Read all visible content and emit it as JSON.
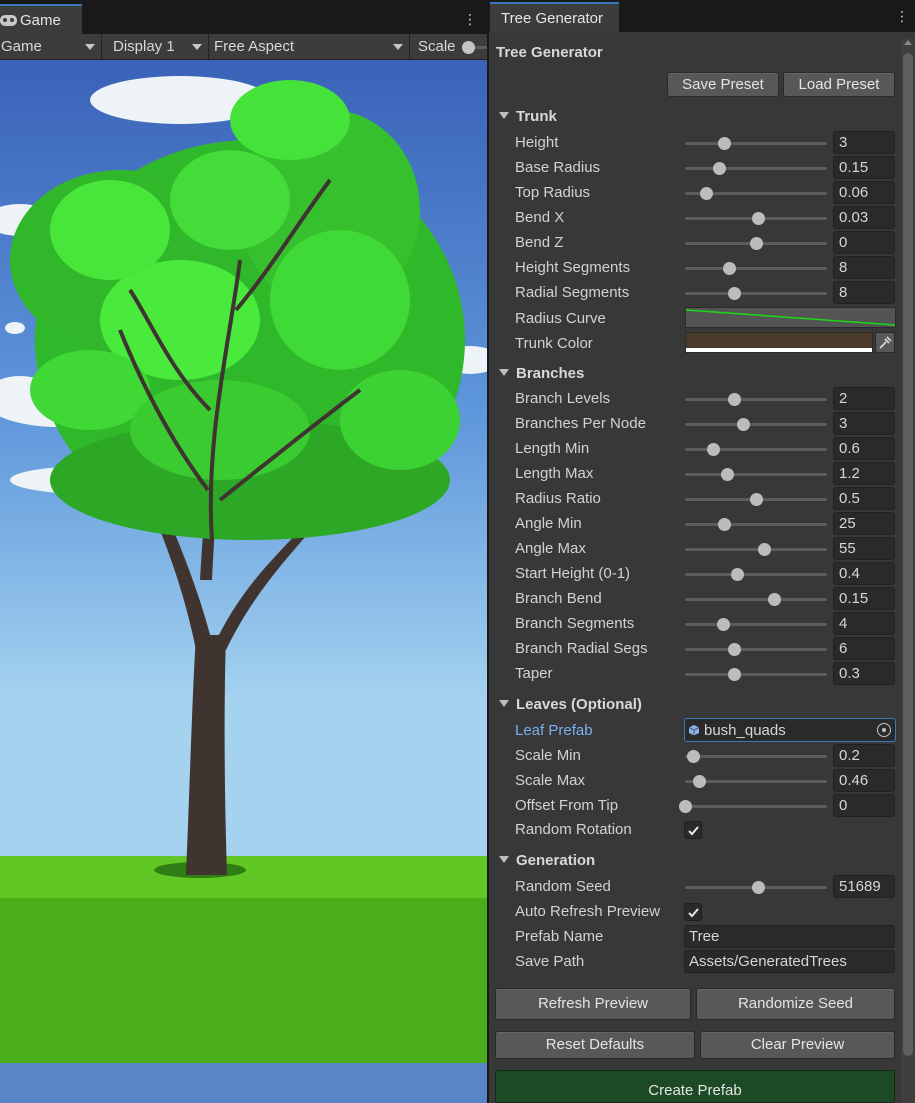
{
  "game_view": {
    "tab_label": "Game",
    "tab_icon": "gamepad-icon",
    "toolbar": {
      "mode": "Game",
      "display": "Display 1",
      "aspect": "Free Aspect",
      "scale_label": "Scale"
    },
    "colors": {
      "sky_top": "#3d6fc4",
      "sky_bottom": "#9fd0ee",
      "leaves": "#3fe83a",
      "trunk": "#3f3430",
      "grass_light": "#5fc723",
      "grass_dark": "#47a91a",
      "ground_blue": "#5a84c8"
    }
  },
  "panel": {
    "tab_label": "Tree Generator",
    "title": "Tree Generator",
    "save_preset": "Save Preset",
    "load_preset": "Load Preset",
    "trunk": {
      "header": "Trunk",
      "height": {
        "label": "Height",
        "value": "3",
        "slider": 0.28
      },
      "base_radius": {
        "label": "Base Radius",
        "value": "0.15",
        "slider": 0.24
      },
      "top_radius": {
        "label": "Top Radius",
        "value": "0.06",
        "slider": 0.15
      },
      "bend_x": {
        "label": "Bend X",
        "value": "0.03",
        "slider": 0.52
      },
      "bend_z": {
        "label": "Bend Z",
        "value": "0",
        "slider": 0.5
      },
      "height_segments": {
        "label": "Height Segments",
        "value": "8",
        "slider": 0.31
      },
      "radial_segments": {
        "label": "Radial Segments",
        "value": "8",
        "slider": 0.35
      },
      "radius_curve": {
        "label": "Radius Curve"
      },
      "trunk_color": {
        "label": "Trunk Color",
        "color": "#4a3a2b"
      }
    },
    "branches": {
      "header": "Branches",
      "branch_levels": {
        "label": "Branch Levels",
        "value": "2",
        "slider": 0.35
      },
      "branches_per_node": {
        "label": "Branches Per Node",
        "value": "3",
        "slider": 0.41
      },
      "length_min": {
        "label": "Length Min",
        "value": "0.6",
        "slider": 0.2
      },
      "length_max": {
        "label": "Length Max",
        "value": "1.2",
        "slider": 0.3
      },
      "radius_ratio": {
        "label": "Radius Ratio",
        "value": "0.5",
        "slider": 0.5
      },
      "angle_min": {
        "label": "Angle Min",
        "value": "25",
        "slider": 0.28
      },
      "angle_max": {
        "label": "Angle Max",
        "value": "55",
        "slider": 0.56
      },
      "start_height": {
        "label": "Start Height (0-1)",
        "value": "0.4",
        "slider": 0.37
      },
      "branch_bend": {
        "label": "Branch Bend",
        "value": "0.15",
        "slider": 0.63
      },
      "branch_segments": {
        "label": "Branch Segments",
        "value": "4",
        "slider": 0.27
      },
      "branch_radial_segs": {
        "label": "Branch Radial Segs",
        "value": "6",
        "slider": 0.35
      },
      "taper": {
        "label": "Taper",
        "value": "0.3",
        "slider": 0.35
      }
    },
    "leaves": {
      "header": "Leaves (Optional)",
      "leaf_prefab": {
        "label": "Leaf Prefab",
        "value": "bush_quads"
      },
      "scale_min": {
        "label": "Scale Min",
        "value": "0.2",
        "slider": 0.06
      },
      "scale_max": {
        "label": "Scale Max",
        "value": "0.46",
        "slider": 0.1
      },
      "offset_from_tip": {
        "label": "Offset From Tip",
        "value": "0",
        "slider": 0.0
      },
      "random_rotation": {
        "label": "Random Rotation",
        "checked": true
      }
    },
    "generation": {
      "header": "Generation",
      "random_seed": {
        "label": "Random Seed",
        "value": "51689",
        "slider": 0.52
      },
      "auto_refresh": {
        "label": "Auto Refresh Preview",
        "checked": true
      },
      "prefab_name": {
        "label": "Prefab Name",
        "value": "Tree"
      },
      "save_path": {
        "label": "Save Path",
        "value": "Assets/GeneratedTrees"
      }
    },
    "buttons": {
      "refresh_preview": "Refresh Preview",
      "randomize_seed": "Randomize Seed",
      "reset_defaults": "Reset Defaults",
      "clear_preview": "Clear Preview",
      "create_prefab": "Create Prefab"
    }
  }
}
